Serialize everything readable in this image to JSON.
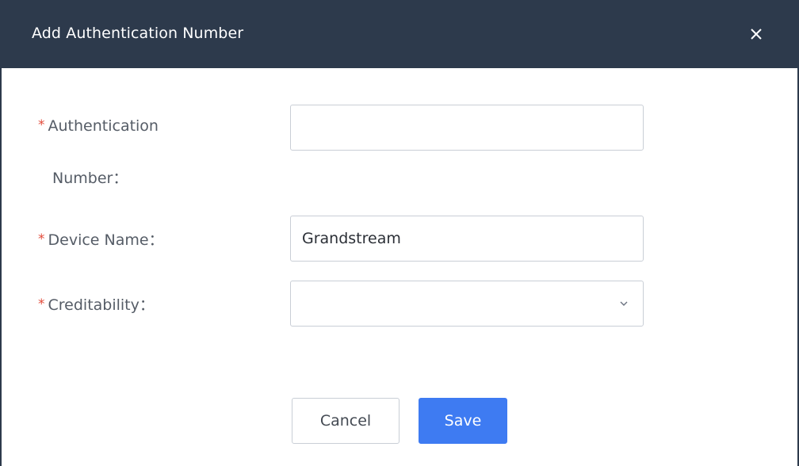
{
  "dialog": {
    "title": "Add Authentication Number",
    "close_icon": "close-icon"
  },
  "form": {
    "required_mark": "*",
    "auth_number": {
      "label_line1": "Authentication",
      "label_line2": "Number：",
      "value": ""
    },
    "device_name": {
      "label": "Device Name：",
      "value": "Grandstream"
    },
    "creditability": {
      "label": "Creditability：",
      "selected": "",
      "icon": "chevron-down-icon"
    }
  },
  "footer": {
    "cancel_label": "Cancel",
    "save_label": "Save"
  },
  "colors": {
    "header_bg": "#2d3a4c",
    "required": "#e24b3b",
    "primary": "#3e7bf2"
  }
}
